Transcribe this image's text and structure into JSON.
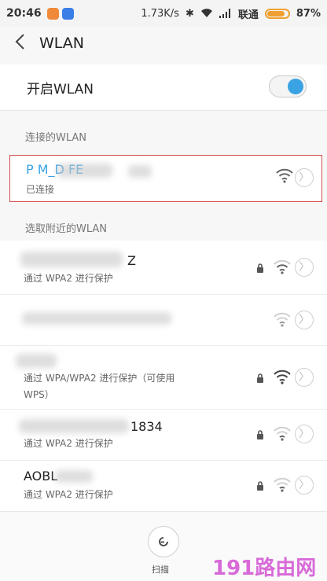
{
  "status": {
    "time": "20:46",
    "speed": "1.73K/s",
    "carrier": "联通",
    "battery": "87%",
    "battery_level": 0.87,
    "colors": {
      "app_orange": "#f08a3a",
      "app_blue": "#3a7ee8",
      "battery": "#f0a030"
    }
  },
  "header": {
    "back_icon": "chevron-left",
    "title": "WLAN"
  },
  "toggle_row": {
    "label": "开启WLAN",
    "enabled": true,
    "color": "#3aa3e4"
  },
  "connected_section": {
    "title": "连接的WLAN"
  },
  "connected": {
    "name": "P M_D FE",
    "status": "已连接"
  },
  "nearby_section": {
    "title": "选取附近的WLAN"
  },
  "networks": [
    {
      "name": "Z",
      "security": "通过 WPA2 进行保护",
      "locked": true
    },
    {
      "name": "",
      "security": "",
      "locked": false
    },
    {
      "name": "",
      "security": "通过 WPA/WPA2 进行保护（可使用",
      "security2": "WPS）",
      "locked": true
    },
    {
      "name": "1834",
      "security": "通过 WPA2 进行保护",
      "locked": true
    },
    {
      "name": "AOBL",
      "security": "通过 WPA2 进行保护",
      "locked": true
    }
  ],
  "bottom": {
    "scan_label": "扫描"
  },
  "watermark": "191路由网"
}
